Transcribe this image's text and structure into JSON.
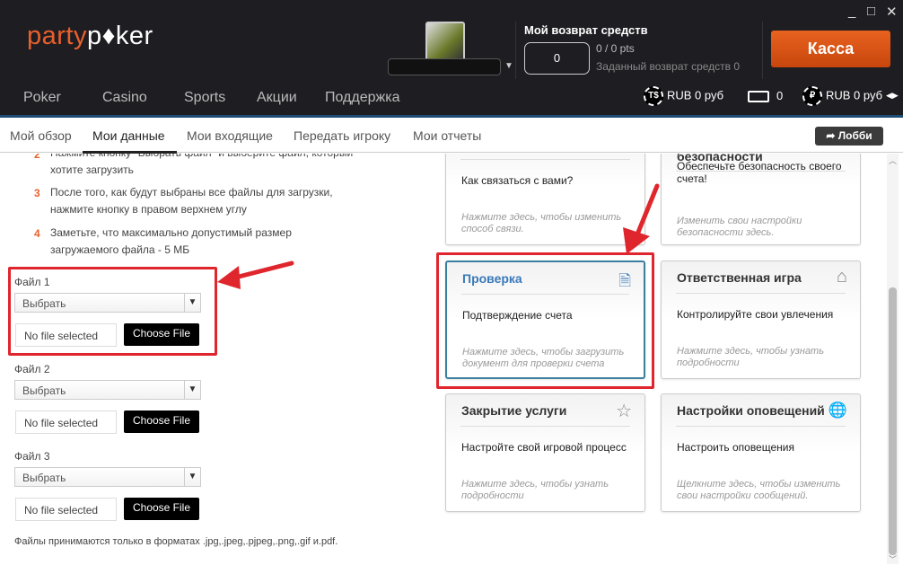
{
  "header": {
    "logo_part1": "party",
    "logo_part2": "p♦ker",
    "window_controls": [
      "_",
      "□",
      "✕"
    ],
    "cashback": {
      "title": "Мой возврат средств",
      "value": "0",
      "pts": "0 / 0 pts",
      "target": "Заданный возврат средств 0"
    },
    "cashier_label": "Касса",
    "nav": [
      "Poker",
      "Casino",
      "Sports",
      "Акции",
      "Поддержка"
    ],
    "balances": {
      "tournament_dollars": "RUB 0 руб",
      "tickets": "0",
      "cash": "RUB 0 руб"
    }
  },
  "subnav": {
    "items": [
      "Мой обзор",
      "Мои данные",
      "Мои входящие",
      "Передать игроку",
      "Мои отчеты"
    ],
    "active": 1,
    "lobby_label": "Лобби"
  },
  "steps": [
    {
      "n": "2",
      "text": "Нажмите кнопку \"Выбрать файл\" и выберите файл, который хотите загрузить"
    },
    {
      "n": "3",
      "text": "После того, как будут выбраны все файлы для загрузки, нажмите кнопку в правом верхнем углу"
    },
    {
      "n": "4",
      "text": "Заметьте, что максимально допустимый размер загружаемого файла - 5 МБ"
    }
  ],
  "files": [
    {
      "label": "Файл 1",
      "select": "Выбрать",
      "status": "No file selected",
      "button": "Choose File"
    },
    {
      "label": "Файл 2",
      "select": "Выбрать",
      "status": "No file selected",
      "button": "Choose File"
    },
    {
      "label": "Файл 3",
      "select": "Выбрать",
      "status": "No file selected",
      "button": "Choose File"
    }
  ],
  "formats_note": "Файлы принимаются только в форматах .jpg,.jpeg,.pjpeg,.png,.gif и.pdf.",
  "cards": [
    {
      "title": "",
      "desc": "Как связаться с вами?",
      "hint": "Нажмите здесь, чтобы изменить способ связи.",
      "icon": ""
    },
    {
      "title": "безопасности",
      "desc": "Обеспечьте безопасность своего счета!",
      "hint": "Изменить свои настройки безопасности здесь.",
      "icon": ""
    },
    {
      "title": "Проверка",
      "desc": "Подтверждение счета",
      "hint": "Нажмите здесь, чтобы загрузить документ для проверки счета",
      "icon": "document-check-icon"
    },
    {
      "title": "Ответственная игра",
      "desc": "Контролируйте свои увлечения",
      "hint": "Нажмите здесь, чтобы узнать подробности",
      "icon": "house-icon"
    },
    {
      "title": "Закрытие услуги",
      "desc": "Настройте свой игровой процесс",
      "hint": "Нажмите здесь, чтобы узнать подробности",
      "icon": "star-icon"
    },
    {
      "title": "Настройки оповещений",
      "desc": "Настроить оповещения",
      "hint": "Щелкните здесь, чтобы изменить свои настройки сообщений.",
      "icon": "globe-icon"
    }
  ],
  "colors": {
    "brand": "#e8602c",
    "highlight": "#e0262d",
    "active_card": "#3a7ab8"
  }
}
